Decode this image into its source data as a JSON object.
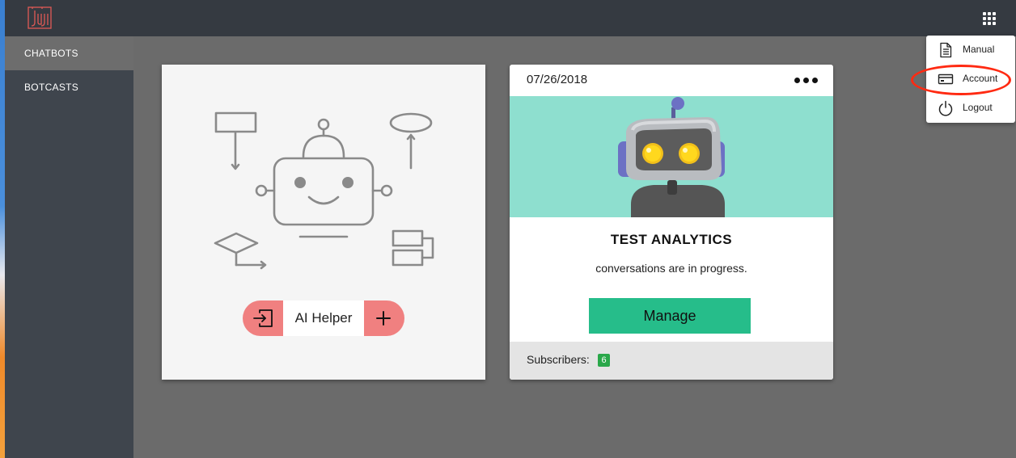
{
  "app": {
    "logo_text": "Juji"
  },
  "sidebar": {
    "items": [
      {
        "label": "CHATBOTS"
      },
      {
        "label": "BOTCASTS"
      }
    ]
  },
  "new_bot_card": {
    "helper_label": "AI Helper"
  },
  "bot_card": {
    "date": "07/26/2018",
    "title": "TEST ANALYTICS",
    "description": "conversations are in progress.",
    "manage_label": "Manage",
    "subscribers_label": "Subscribers:",
    "subscribers_count": "6"
  },
  "account_menu": {
    "items": [
      {
        "label": "Manual",
        "icon": "document-icon"
      },
      {
        "label": "Account",
        "icon": "credit-card-icon"
      },
      {
        "label": "Logout",
        "icon": "power-icon"
      }
    ]
  },
  "colors": {
    "topbar": "#353a41",
    "sidebar": "#3f454d",
    "content_bg": "#6b6b6b",
    "accent_green": "#26bd8a",
    "pill_red": "#f08080",
    "banner_teal": "#8edfcf",
    "highlight_red": "#ff2a12"
  }
}
